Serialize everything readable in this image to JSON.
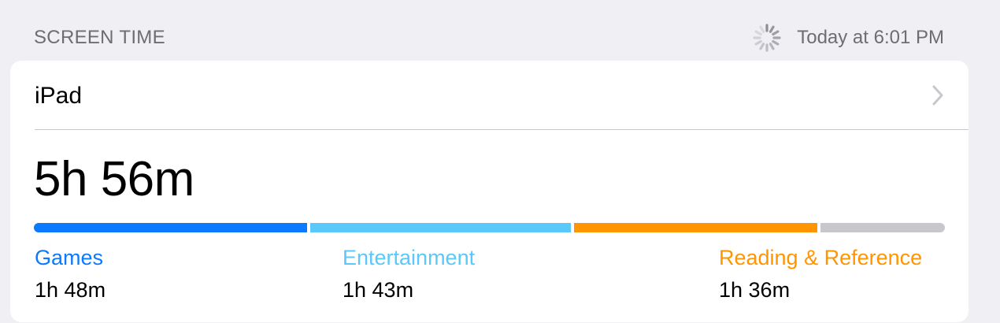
{
  "section": {
    "title": "SCREEN TIME",
    "timestamp": "Today at 6:01 PM",
    "spinner_icon": "activity-spinner-icon"
  },
  "device": {
    "name": "iPad",
    "chevron_icon": "chevron-right-icon",
    "total_time": "5h 56m"
  },
  "usage": {
    "total_minutes": 356,
    "categories": [
      {
        "label": "Games",
        "value": "1h 48m",
        "minutes": 108,
        "color": "#0a7aff"
      },
      {
        "label": "Entertainment",
        "value": "1h 43m",
        "minutes": 103,
        "color": "#5ac8fa"
      },
      {
        "label": "Reading & Reference",
        "value": "1h 36m",
        "minutes": 96,
        "color": "#ff9500"
      }
    ],
    "other_color": "#c7c7cc"
  }
}
